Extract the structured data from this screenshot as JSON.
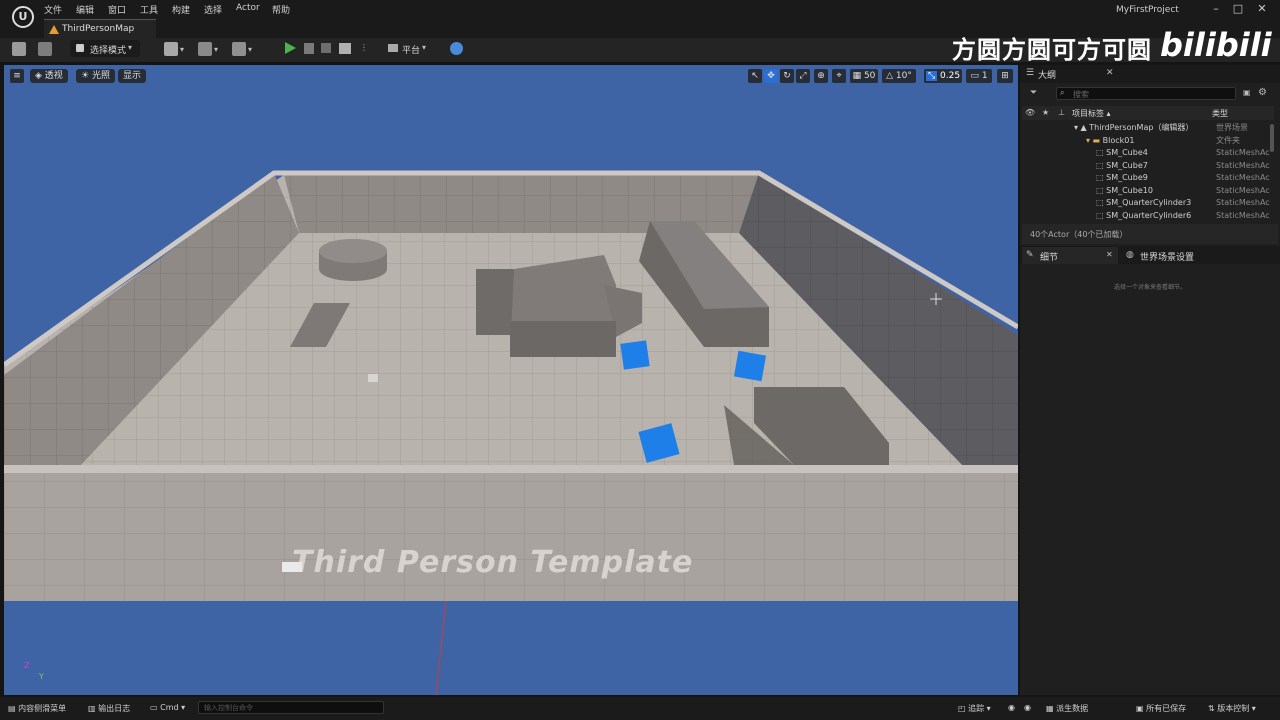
{
  "app": {
    "logo": "U",
    "project": "MyFirstProject",
    "map_tab": "ThirdPersonMap",
    "menu": [
      "文件",
      "编辑",
      "窗口",
      "工具",
      "构建",
      "选择",
      "Actor",
      "帮助"
    ],
    "window_buttons": [
      "–",
      "□",
      "✕"
    ]
  },
  "toolbar": {
    "select_mode": "选择模式",
    "platform": "平台",
    "watermark": "方圆方圆可方可圆",
    "bili": "bilibili"
  },
  "viewport": {
    "buttons": [
      "透视",
      "光照",
      "显示"
    ],
    "grid": "50",
    "angle": "10°",
    "scale": "0.25",
    "camera_speed": "1",
    "floor_text": "Third Person Template",
    "axis_labels": {
      "z": "Z",
      "y": "Y"
    }
  },
  "outliner": {
    "title": "大纲",
    "search_placeholder": "搜索",
    "col_label": "项目标签 ▴",
    "col_type": "类型",
    "rows": [
      {
        "name": "ThirdPersonMap（编辑器）",
        "type": "世界场景"
      },
      {
        "name": "Block01",
        "type": "文件夹"
      },
      {
        "name": "SM_Cube4",
        "type": "StaticMeshAc"
      },
      {
        "name": "SM_Cube7",
        "type": "StaticMeshAc"
      },
      {
        "name": "SM_Cube9",
        "type": "StaticMeshAc"
      },
      {
        "name": "SM_Cube10",
        "type": "StaticMeshAc"
      },
      {
        "name": "SM_QuarterCylinder3",
        "type": "StaticMeshAc"
      },
      {
        "name": "SM_QuarterCylinder6",
        "type": "StaticMeshAc"
      }
    ],
    "count": "40个Actor（40个已加载）"
  },
  "details": {
    "tab": "细节",
    "world_tab": "世界场景设置",
    "hint": "选择一个对象来查看细节。"
  },
  "bottombar": {
    "content_drawer": "内容侧滑菜单",
    "output_log": "输出日志",
    "cmd": "Cmd",
    "console_placeholder": "输入控制台命令",
    "trace": "追踪",
    "derived_data": "派生数据",
    "all_saved": "所有已保存",
    "source_control": "版本控制"
  },
  "colors": {
    "viewport_sky": "#3f64a6",
    "blue_cube": "#1f7fe8",
    "play_green": "#4db14d"
  }
}
